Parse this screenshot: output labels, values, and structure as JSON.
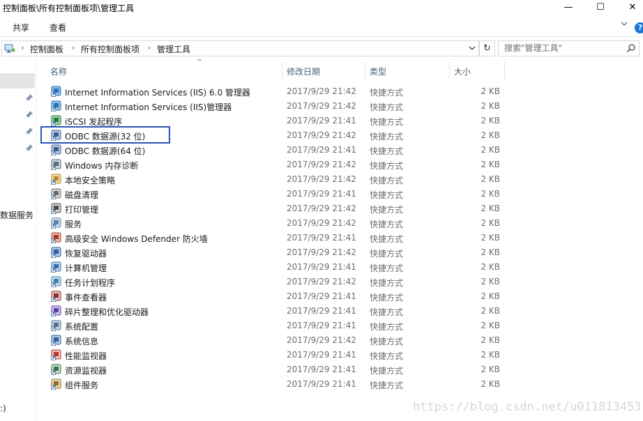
{
  "window": {
    "title": "控制面板\\所有控制面板项\\管理工具",
    "minimize_glyph": "—",
    "maximize_glyph": "☐",
    "close_glyph": "✕"
  },
  "ribbon": {
    "tabs": [
      "共享",
      "查看"
    ],
    "help_glyph": "?"
  },
  "address": {
    "crumbs": [
      "控制面板",
      "所有控制面板项",
      "管理工具"
    ],
    "separator_glyph": "›",
    "dropdown_glyph": "⌄",
    "refresh_glyph": "↻"
  },
  "search": {
    "placeholder": "搜索\"管理工具\""
  },
  "navpane": {
    "items": [
      "数据服务",
      ":)"
    ]
  },
  "columns": {
    "name": "名称",
    "date": "修改日期",
    "type": "类型",
    "size": "大小",
    "sort_glyph": "^"
  },
  "files": [
    {
      "name": "Internet Information Services (IIS) 6.0 管理器",
      "date": "2017/9/29 21:42",
      "type": "快捷方式",
      "size": "2 KB",
      "icon": "iis-icon"
    },
    {
      "name": "Internet Information Services (IIS)管理器",
      "date": "2017/9/29 21:42",
      "type": "快捷方式",
      "size": "2 KB",
      "icon": "iis-icon"
    },
    {
      "name": "iSCSI 发起程序",
      "date": "2017/9/29 21:41",
      "type": "快捷方式",
      "size": "2 KB",
      "icon": "iscsi-icon"
    },
    {
      "name": "ODBC 数据源(32 位)",
      "date": "2017/9/29 21:42",
      "type": "快捷方式",
      "size": "2 KB",
      "icon": "odbc-icon"
    },
    {
      "name": "ODBC 数据源(64 位)",
      "date": "2017/9/29 21:41",
      "type": "快捷方式",
      "size": "2 KB",
      "icon": "odbc-icon"
    },
    {
      "name": "Windows 内存诊断",
      "date": "2017/9/29 21:42",
      "type": "快捷方式",
      "size": "2 KB",
      "icon": "memory-diagnostic-icon"
    },
    {
      "name": "本地安全策略",
      "date": "2017/9/29 21:42",
      "type": "快捷方式",
      "size": "2 KB",
      "icon": "security-policy-icon"
    },
    {
      "name": "磁盘清理",
      "date": "2017/9/29 21:41",
      "type": "快捷方式",
      "size": "2 KB",
      "icon": "disk-cleanup-icon"
    },
    {
      "name": "打印管理",
      "date": "2017/9/29 21:42",
      "type": "快捷方式",
      "size": "2 KB",
      "icon": "print-management-icon"
    },
    {
      "name": "服务",
      "date": "2017/9/29 21:42",
      "type": "快捷方式",
      "size": "2 KB",
      "icon": "services-gear-icon"
    },
    {
      "name": "高级安全 Windows Defender 防火墙",
      "date": "2017/9/29 21:41",
      "type": "快捷方式",
      "size": "2 KB",
      "icon": "firewall-icon"
    },
    {
      "name": "恢复驱动器",
      "date": "2017/9/29 21:42",
      "type": "快捷方式",
      "size": "2 KB",
      "icon": "recovery-drive-icon"
    },
    {
      "name": "计算机管理",
      "date": "2017/9/29 21:41",
      "type": "快捷方式",
      "size": "2 KB",
      "icon": "computer-management-icon"
    },
    {
      "name": "任务计划程序",
      "date": "2017/9/29 21:42",
      "type": "快捷方式",
      "size": "2 KB",
      "icon": "task-scheduler-icon"
    },
    {
      "name": "事件查看器",
      "date": "2017/9/29 21:41",
      "type": "快捷方式",
      "size": "2 KB",
      "icon": "event-viewer-icon"
    },
    {
      "name": "碎片整理和优化驱动器",
      "date": "2017/9/29 21:41",
      "type": "快捷方式",
      "size": "2 KB",
      "icon": "defrag-icon"
    },
    {
      "name": "系统配置",
      "date": "2017/9/29 21:41",
      "type": "快捷方式",
      "size": "2 KB",
      "icon": "system-config-icon"
    },
    {
      "name": "系统信息",
      "date": "2017/9/29 21:42",
      "type": "快捷方式",
      "size": "2 KB",
      "icon": "system-info-icon"
    },
    {
      "name": "性能监视器",
      "date": "2017/9/29 21:41",
      "type": "快捷方式",
      "size": "2 KB",
      "icon": "performance-monitor-icon"
    },
    {
      "name": "资源监视器",
      "date": "2017/9/29 21:41",
      "type": "快捷方式",
      "size": "2 KB",
      "icon": "resource-monitor-icon"
    },
    {
      "name": "组件服务",
      "date": "2017/9/29 21:41",
      "type": "快捷方式",
      "size": "2 KB",
      "icon": "component-services-icon"
    }
  ],
  "watermark": "https://blog.csdn.net/u011813453",
  "colors": {
    "highlight_border": "#2c52b8",
    "header_text": "#4c607a",
    "help_blue": "#1877d6"
  }
}
